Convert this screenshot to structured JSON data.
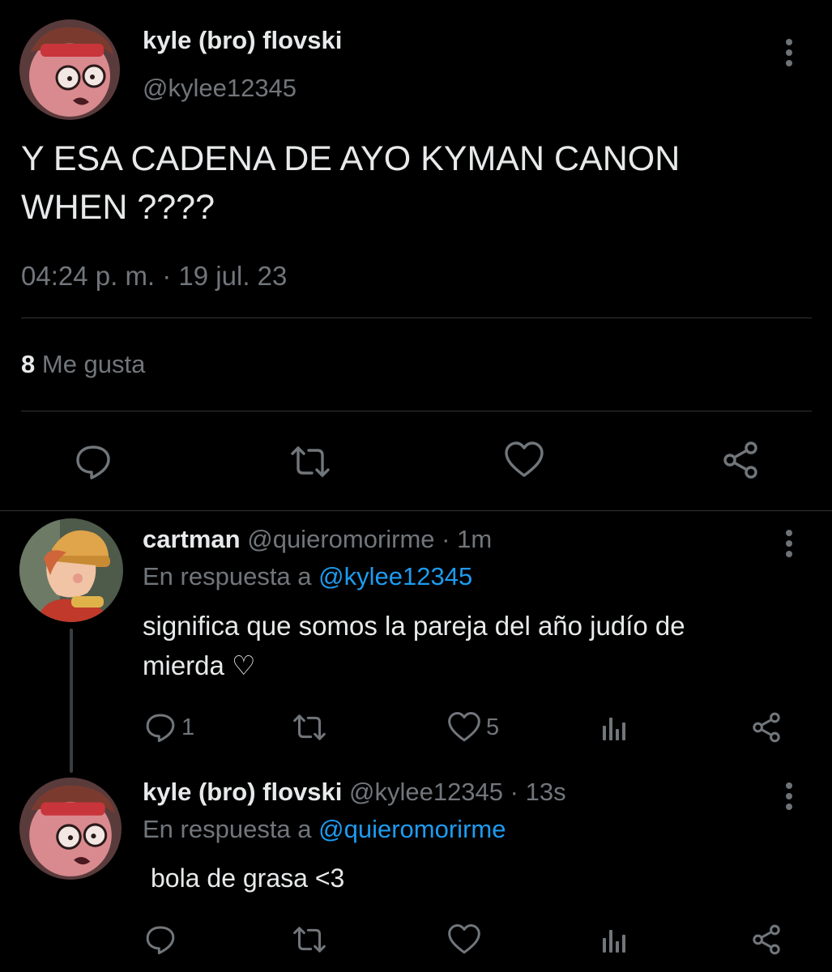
{
  "main_tweet": {
    "author_name": "kyle (bro) flovski",
    "author_handle": "@kylee12345",
    "text_line1": "Y ESA CADENA DE AYO KYMAN CANON",
    "text_line2": "WHEN ????",
    "timestamp": "04:24 p. m. · 19 jul. 23",
    "likes_count": "8",
    "likes_label": "Me gusta"
  },
  "reply1": {
    "author_name": "cartman",
    "author_handle": "@quieromorirme",
    "time": "· 1m",
    "replying_prefix": "En respuesta a",
    "replying_to": "@kylee12345",
    "text_line1": "significa que somos la pareja del año judío de",
    "text_line2": "mierda ♡",
    "reply_count": "1",
    "like_count": "5"
  },
  "reply2": {
    "author_name": "kyle (bro) flovski",
    "author_handle": "@kylee12345",
    "time": "· 13s",
    "replying_prefix": "En respuesta a",
    "replying_to": "@quieromorirme",
    "text": "bola de grasa <3"
  },
  "icons": {
    "reply": "speech-bubble-icon",
    "retweet": "retweet-icon",
    "like": "heart-icon",
    "share": "share-icon",
    "views": "analytics-icon",
    "more": "kebab-menu-icon"
  },
  "colors": {
    "background": "#000000",
    "text": "#e7e9ea",
    "muted": "#71767b",
    "link": "#1d9bf0",
    "divider": "#2f3336"
  }
}
